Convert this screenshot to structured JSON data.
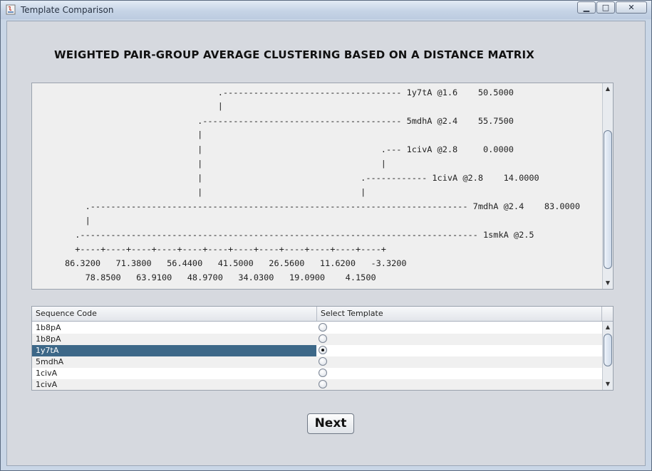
{
  "window": {
    "title": "Template Comparison",
    "controls": {
      "minimize": "▁",
      "maximize": "□",
      "close": "✕"
    }
  },
  "heading": "WEIGHTED PAIR-GROUP AVERAGE CLUSTERING BASED ON A DISTANCE MATRIX",
  "dendrogram": {
    "lines": [
      "                                    .                                                          ",
      "                                    .----------------------------------- 1y7tA @1.6    50.5000",
      "                                    |",
      "                                .--------------------------------------- 5mdhA @2.4    55.7500",
      "                                |",
      "                                |                                   .--- 1civA @2.8     0.0000",
      "                                |                                   |",
      "                                |                               .------------ 1civA @2.8    14.0000",
      "                                |                               |",
      "          .-------------------------------------------------------------------------- 7mdhA @2.4    83.0000",
      "          |",
      "        .------------------------------------------------------------------------------ 1smkA @2.5",
      "        +----+----+----+----+----+----+----+----+----+----+----+----+",
      "      86.3200   71.3800   56.4400   41.5000   26.5600   11.6200   -3.3200",
      "          78.8500   63.9100   48.9700   34.0300   19.0900    4.1500"
    ]
  },
  "table": {
    "columns": [
      "Sequence Code",
      "Select Template"
    ],
    "rows": [
      {
        "code": "1b8pA",
        "selected": false
      },
      {
        "code": "1b8pA",
        "selected": false
      },
      {
        "code": "1y7tA",
        "selected": true
      },
      {
        "code": "5mdhA",
        "selected": false
      },
      {
        "code": "1civA",
        "selected": false
      },
      {
        "code": "1civA",
        "selected": false
      }
    ],
    "scroll_up": "▲",
    "scroll_down": "▼"
  },
  "next_label": "Next",
  "colors": {
    "selection": "#3d6888",
    "titlebar": "#c6d4e6"
  }
}
